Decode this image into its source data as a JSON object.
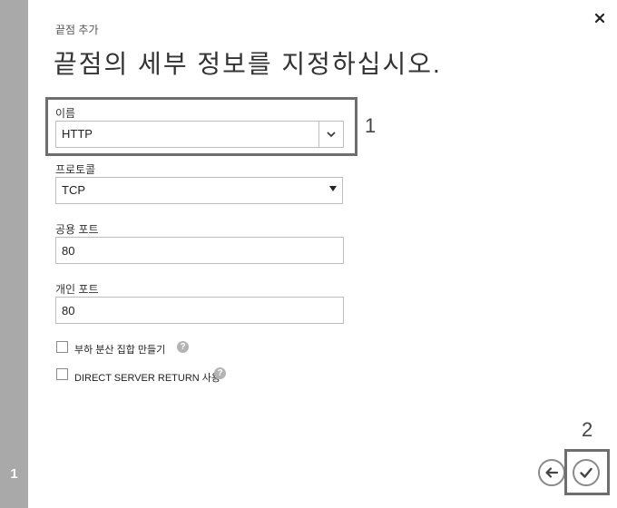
{
  "dialog": {
    "subtitle": "끝점 추가",
    "title": "끝점의 세부 정보를 지정하십시오.",
    "step_number": "1"
  },
  "fields": {
    "name": {
      "label": "이름",
      "value": "HTTP"
    },
    "protocol": {
      "label": "프로토콜",
      "value": "TCP"
    },
    "public_port": {
      "label": "공용 포트",
      "value": "80"
    },
    "private_port": {
      "label": "개인 포트",
      "value": "80"
    }
  },
  "options": {
    "load_balanced": {
      "label": "부하 분산 집합 만들기",
      "checked": false
    },
    "direct_server_return": {
      "label": "DIRECT SERVER RETURN 사용",
      "checked": false
    }
  },
  "annotations": {
    "first": "1",
    "second": "2"
  },
  "icons": {
    "close": "close-icon",
    "chevron": "chevron-down-icon",
    "help": "question-icon",
    "back": "arrow-left-icon",
    "confirm": "check-icon"
  }
}
